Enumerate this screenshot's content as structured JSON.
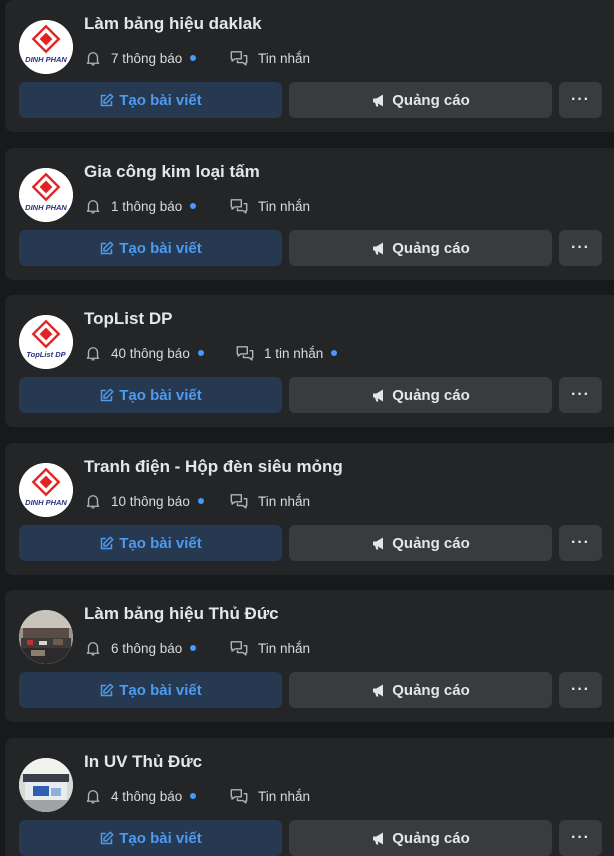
{
  "colors": {
    "background": "#18191a",
    "card": "#242526",
    "create_button_bg": "#263951",
    "create_button_text": "#4d9bf0",
    "secondary_button_bg": "#3a3b3c",
    "unread_dot": "#4599ff",
    "logo_red": "#e32323"
  },
  "pages": [
    {
      "name": "Làm bảng hiệu daklak",
      "avatar": {
        "type": "logo",
        "caption": "DINH PHAN"
      },
      "notifications": "7 thông báo",
      "notifications_unread": true,
      "messages": "Tin nhắn",
      "messages_unread": false,
      "create_post": "Tạo bài viết",
      "ads": "Quảng cáo",
      "more": "···"
    },
    {
      "name": "Gia công kim loại tấm",
      "avatar": {
        "type": "logo",
        "caption": "DINH PHAN"
      },
      "notifications": "1 thông báo",
      "notifications_unread": true,
      "messages": "Tin nhắn",
      "messages_unread": false,
      "create_post": "Tạo bài viết",
      "ads": "Quảng cáo",
      "more": "···"
    },
    {
      "name": "TopList DP",
      "avatar": {
        "type": "logo",
        "caption": "TopList DP"
      },
      "notifications": "40 thông báo",
      "notifications_unread": true,
      "messages": "1 tin nhắn",
      "messages_unread": true,
      "create_post": "Tạo bài viết",
      "ads": "Quảng cáo",
      "more": "···"
    },
    {
      "name": "Tranh điện - Hộp đèn siêu mỏng",
      "avatar": {
        "type": "logo",
        "caption": "DINH PHAN"
      },
      "notifications": "10 thông báo",
      "notifications_unread": true,
      "messages": "Tin nhắn",
      "messages_unread": false,
      "create_post": "Tạo bài viết",
      "ads": "Quảng cáo",
      "more": "···"
    },
    {
      "name": "Làm bảng hiệu Thủ Đức",
      "avatar": {
        "type": "photo-workshop"
      },
      "notifications": "6 thông báo",
      "notifications_unread": true,
      "messages": "Tin nhắn",
      "messages_unread": false,
      "create_post": "Tạo bài viết",
      "ads": "Quảng cáo",
      "more": "···"
    },
    {
      "name": "In UV Thủ Đức",
      "avatar": {
        "type": "photo-printer"
      },
      "notifications": "4 thông báo",
      "notifications_unread": true,
      "messages": "Tin nhắn",
      "messages_unread": false,
      "create_post": "Tạo bài viết",
      "ads": "Quảng cáo",
      "more": "···"
    }
  ]
}
